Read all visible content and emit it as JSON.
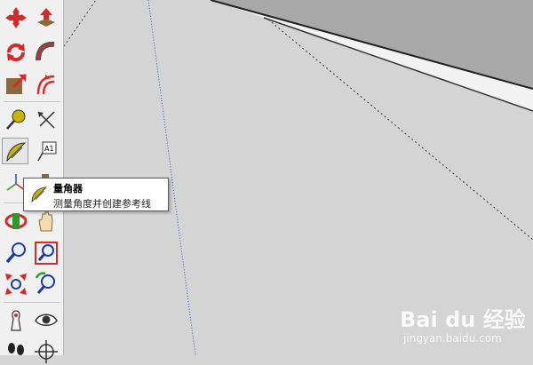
{
  "tooltip": {
    "title": "量角器",
    "description": "测量角度并创建参考线"
  },
  "toolbar": {
    "icons": [
      "move-icon",
      "push-pull-icon",
      "rotate-icon",
      "follow-me-icon",
      "scale-icon",
      "offset-icon",
      "tape-measure-icon",
      "dimension-icon",
      "protractor-icon",
      "text-icon",
      "axes-icon",
      "3d-text-icon",
      "orbit-icon",
      "pan-icon",
      "zoom-icon",
      "zoom-window-icon",
      "zoom-extents-icon",
      "previous-view-icon",
      "position-camera-icon",
      "look-around-icon",
      "walk-icon",
      "section-plane-icon"
    ],
    "text_tool_label": "A1"
  },
  "watermark": {
    "brand": "Bai du 经验",
    "url": "jingyan.baidu.com"
  },
  "colors": {
    "canvas": "#d4d4d4",
    "toolbar": "#f0f0f0",
    "tool_red": "#d42a2a",
    "protractor_yellow": "#c8b400"
  }
}
